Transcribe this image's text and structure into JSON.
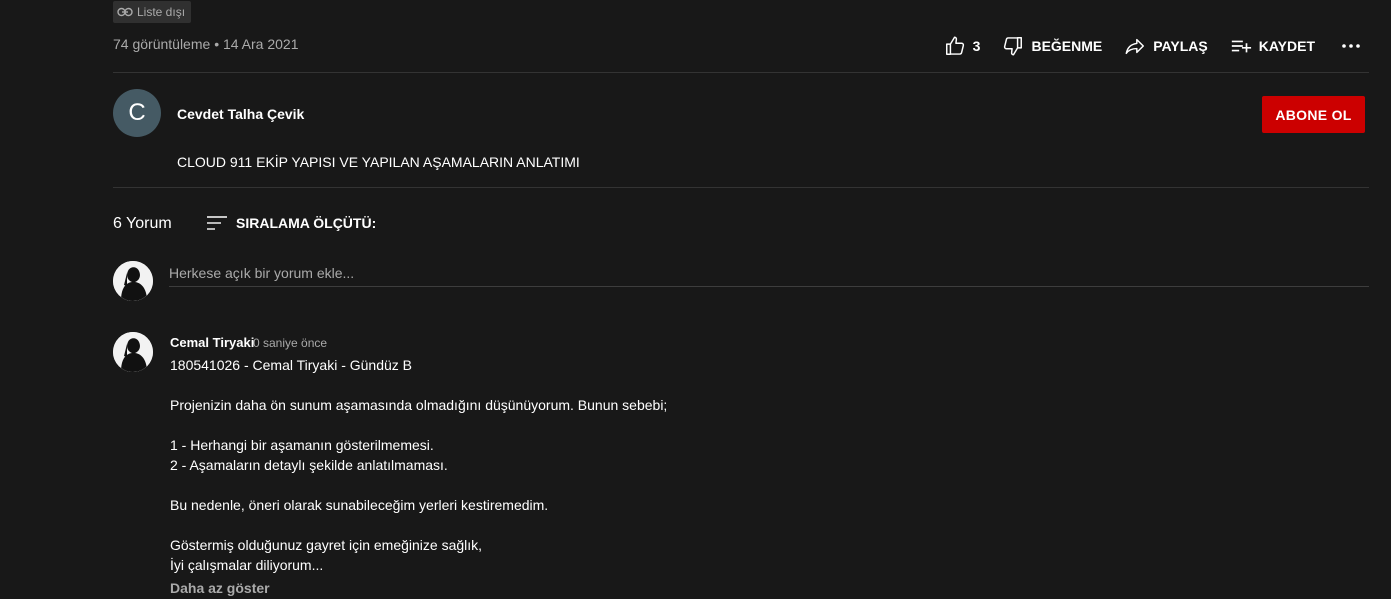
{
  "video": {
    "visibility_badge": "Liste dışı",
    "views": "74 görüntüleme",
    "separator": "•",
    "date": "14 Ara 2021"
  },
  "actions": {
    "like_count": "3",
    "dislike_label": "BEĞENME",
    "share_label": "PAYLAŞ",
    "save_label": "KAYDET"
  },
  "channel": {
    "avatar_letter": "C",
    "avatar_color": "#455a64",
    "name": "Cevdet Talha Çevik",
    "subscribe_label": "ABONE OL",
    "subscribe_color": "#cc0000",
    "description": "CLOUD 911 EKİP YAPISI VE YAPILAN AŞAMALARIN ANLATIMI"
  },
  "comments_section": {
    "count_label": "6 Yorum",
    "sort_label": "SIRALAMA ÖLÇÜTÜ:",
    "add_placeholder": "Herkese açık bir yorum ekle..."
  },
  "comment": {
    "author": "Cemal Tiryaki",
    "time": "0 saniye önce",
    "lines": [
      "180541026 - Cemal Tiryaki - Gündüz B",
      "",
      "Projenizin daha ön sunum aşamasında olmadığını düşünüyorum. Bunun sebebi;",
      "",
      "1 - Herhangi bir aşamanın gösterilmemesi.",
      "2 - Aşamaların detaylı şekilde anlatılmaması.",
      "",
      "Bu nedenle, öneri olarak sunabileceğim yerleri kestiremedim.",
      "",
      "Göstermiş olduğunuz gayret için emeğinize sağlık,",
      "İyi çalışmalar diliyorum..."
    ],
    "show_less_label": "Daha az göster"
  },
  "icons": {
    "link": "link-icon",
    "like": "thumb-up-icon",
    "dislike": "thumb-down-icon",
    "share": "share-icon",
    "save": "playlist-add-icon",
    "more": "more-horizontal-icon",
    "sort": "sort-icon"
  }
}
